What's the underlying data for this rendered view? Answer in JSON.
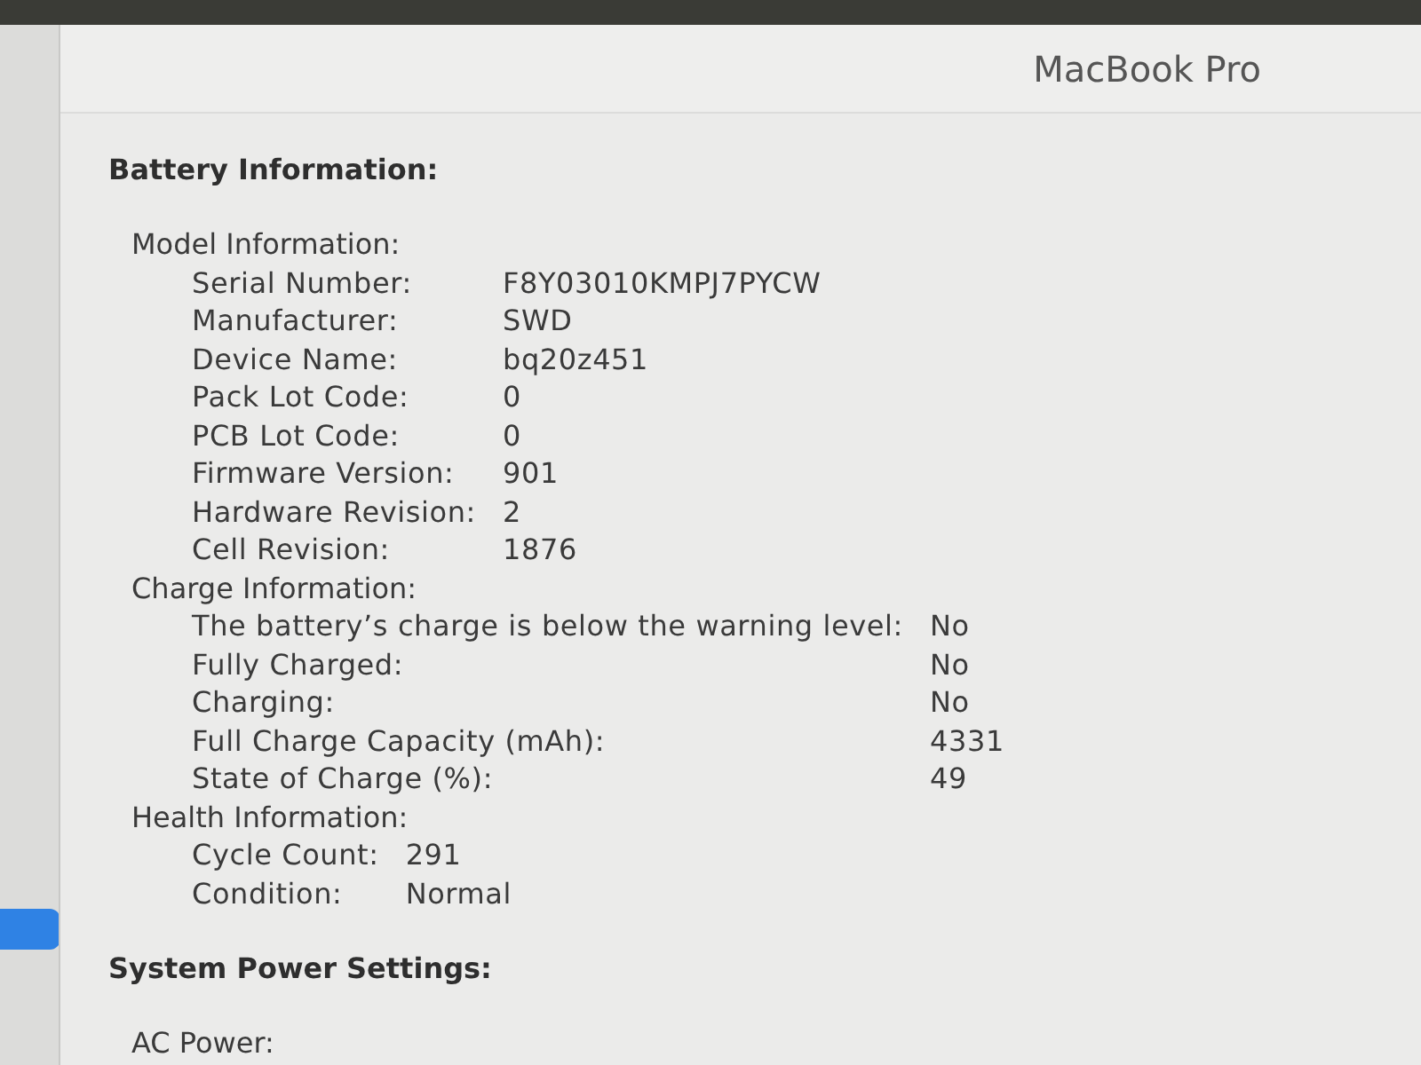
{
  "window": {
    "title": "MacBook Pro"
  },
  "sidebar": {
    "items": [
      {
        "selected": true
      }
    ]
  },
  "sections": [
    {
      "heading": "Battery Information:",
      "groups": [
        {
          "title": "Model Information:",
          "rows": [
            {
              "label": "Serial Number:",
              "value": "F8Y03010KMPJ7PYCW"
            },
            {
              "label": "Manufacturer:",
              "value": "SWD"
            },
            {
              "label": "Device Name:",
              "value": "bq20z451"
            },
            {
              "label": "Pack Lot Code:",
              "value": "0"
            },
            {
              "label": "PCB Lot Code:",
              "value": "0"
            },
            {
              "label": "Firmware Version:",
              "value": "901"
            },
            {
              "label": "Hardware Revision:",
              "value": "2"
            },
            {
              "label": "Cell Revision:",
              "value": "1876"
            }
          ]
        },
        {
          "title": "Charge Information:",
          "rows": [
            {
              "label": "The battery’s charge is below the warning level:",
              "value": "No"
            },
            {
              "label": "Fully Charged:",
              "value": "No"
            },
            {
              "label": "Charging:",
              "value": "No"
            },
            {
              "label": "Full Charge Capacity (mAh):",
              "value": "4331"
            },
            {
              "label": "State of Charge (%):",
              "value": "49"
            }
          ]
        },
        {
          "title": "Health Information:",
          "rows": [
            {
              "label": "Cycle Count:",
              "value": "291"
            },
            {
              "label": "Condition:",
              "value": "Normal"
            }
          ]
        }
      ]
    },
    {
      "heading": "System Power Settings:",
      "groups": [
        {
          "title": "AC Power:"
        }
      ]
    }
  ]
}
